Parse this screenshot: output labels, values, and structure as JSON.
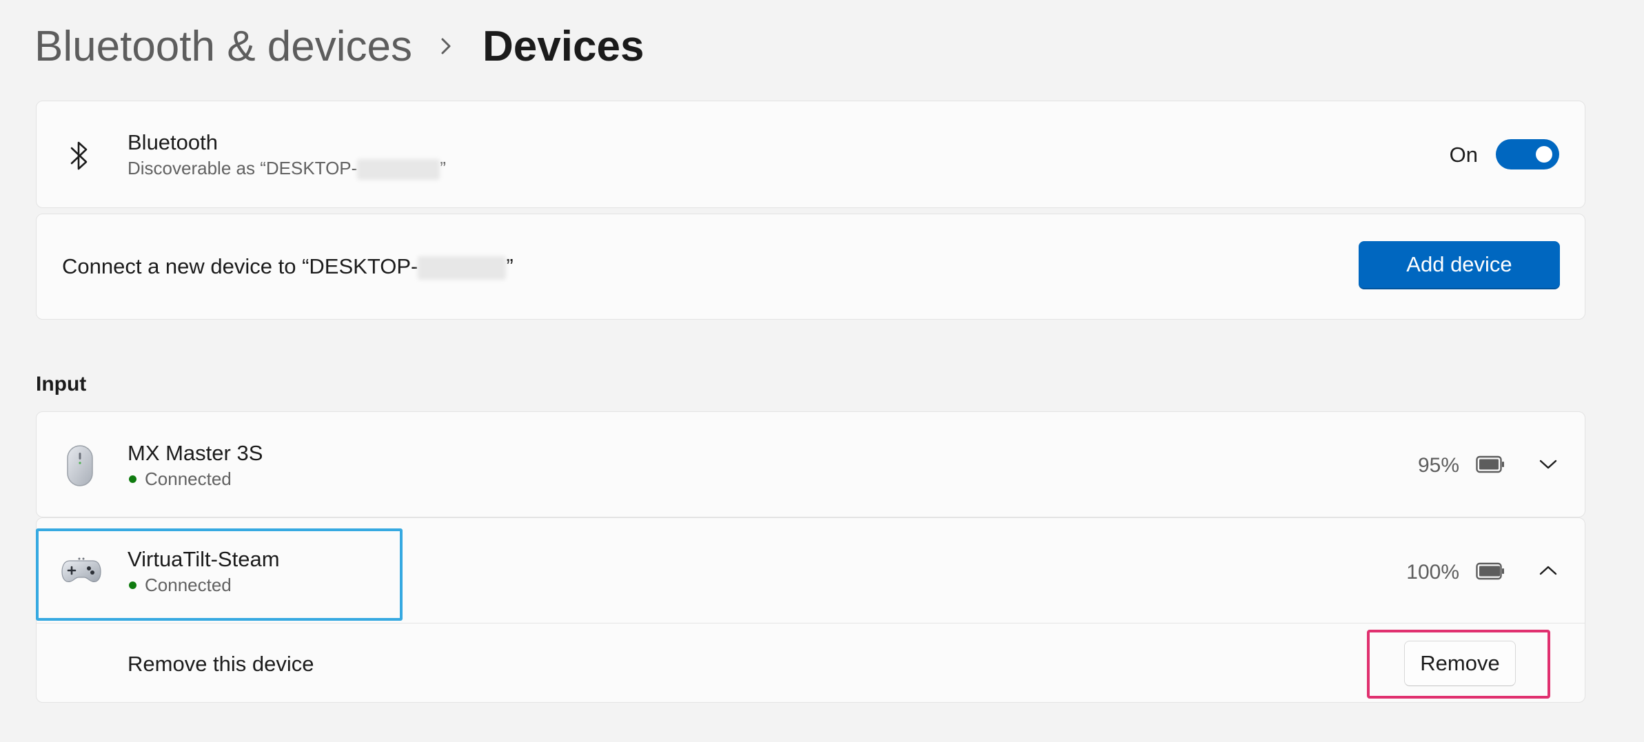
{
  "breadcrumb": {
    "parent": "Bluetooth & devices",
    "current": "Devices"
  },
  "bluetooth": {
    "title": "Bluetooth",
    "subtitle_prefix": "Discoverable as “DESKTOP-",
    "subtitle_suffix": "”",
    "toggle_label": "On",
    "toggle_state": true,
    "icon": "bluetooth-icon"
  },
  "connect": {
    "text_prefix": "Connect a new device to “DESKTOP-",
    "text_suffix": "”",
    "button_label": "Add device"
  },
  "section_input": "Input",
  "devices": [
    {
      "name": "MX Master 3S",
      "status": "Connected",
      "battery": "95%",
      "icon": "mouse-icon",
      "expanded": false
    },
    {
      "name": "VirtuaTilt-Steam",
      "status": "Connected",
      "battery": "100%",
      "icon": "gamepad-icon",
      "expanded": true
    }
  ],
  "remove_row": {
    "label": "Remove this device",
    "button_label": "Remove"
  },
  "colors": {
    "accent": "#0067c0",
    "status_green": "#0f7b0f",
    "highlight_blue": "#36a9e1",
    "highlight_pink": "#e0306f"
  }
}
